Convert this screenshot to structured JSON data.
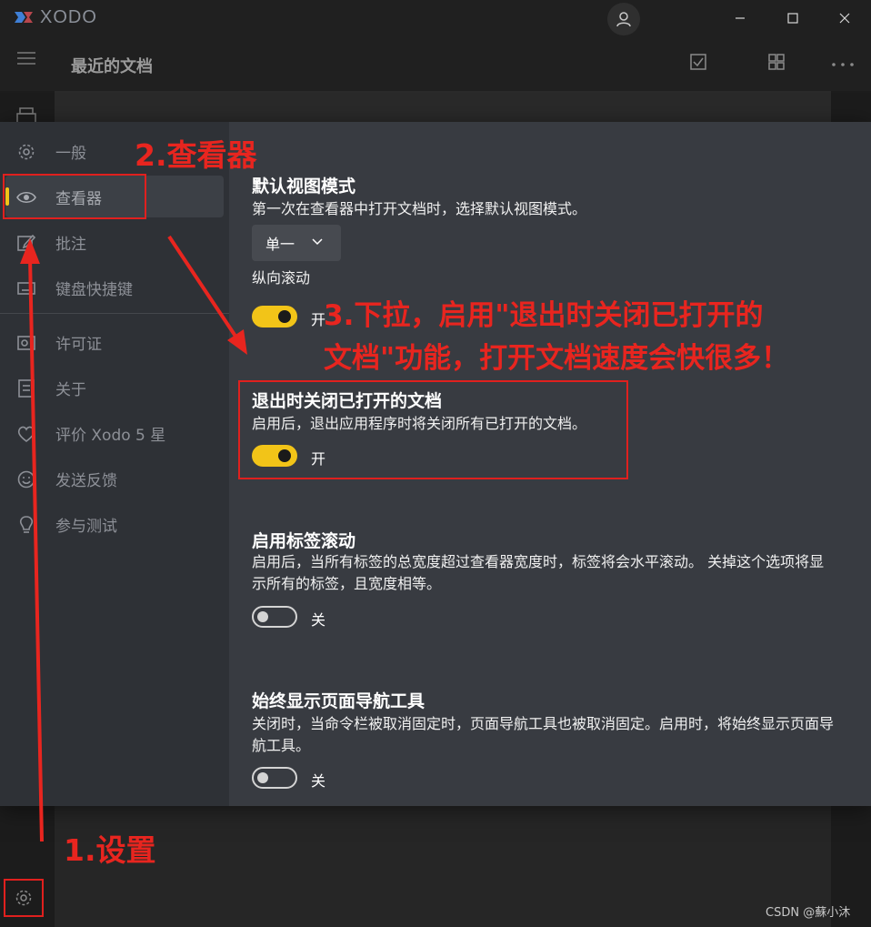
{
  "app": {
    "logo_text": "XODO"
  },
  "appbar": {
    "title": "最近的文档"
  },
  "settings_nav": {
    "items": [
      {
        "label": "一般"
      },
      {
        "label": "查看器"
      },
      {
        "label": "批注"
      },
      {
        "label": "键盘快捷键"
      },
      {
        "label": "许可证"
      },
      {
        "label": "关于"
      },
      {
        "label": "评价 Xodo 5 星"
      },
      {
        "label": "发送反馈"
      },
      {
        "label": "参与测试"
      }
    ]
  },
  "viewer_settings": {
    "default_view": {
      "title": "默认视图模式",
      "desc": "第一次在查看器中打开文档时，选择默认视图模式。",
      "value": "单一",
      "scroll_label": "纵向滚动",
      "state": "开"
    },
    "close_on_exit": {
      "title": "退出时关闭已打开的文档",
      "desc": "启用后，退出应用程序时将关闭所有已打开的文档。",
      "state": "开"
    },
    "tab_scroll": {
      "title": "启用标签滚动",
      "desc": "启用后，当所有标签的总宽度超过查看器宽度时，标签将会水平滚动。 关掉这个选项将显示所有的标签，且宽度相等。",
      "state": "关"
    },
    "page_nav": {
      "title": "始终显示页面导航工具",
      "desc": "关闭时，当命令栏被取消固定时，页面导航工具也被取消固定。启用时，将始终显示页面导航工具。",
      "state": "关"
    }
  },
  "annotations": {
    "step1": "1.设置",
    "step2": "2.查看器",
    "step3_line1": "3.下拉，启用\"退出时关闭已打开的",
    "step3_line2": "文档\"功能，打开文档速度会快很多！"
  },
  "watermark": "CSDN @蘇小沐",
  "colors": {
    "accent": "#f2c418",
    "annotation": "#e0201e",
    "panel": "#383b41",
    "nav": "#2e3136"
  }
}
